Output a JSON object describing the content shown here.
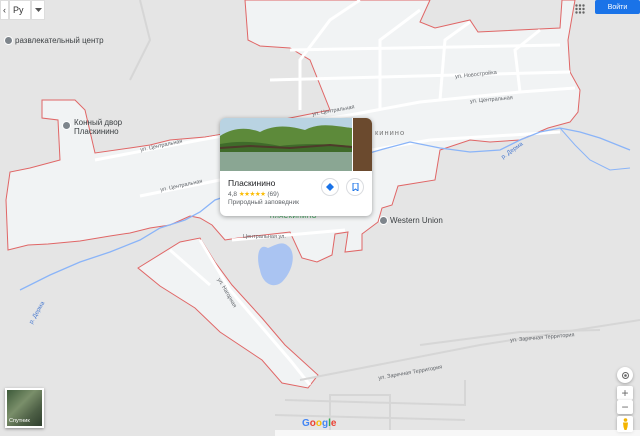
{
  "toolbar": {
    "menu_label": "‹",
    "language": "Ру",
    "language_icon": "chevron-down-icon"
  },
  "labels": {
    "entertainment_center": "развлекательный центр",
    "horse_yard_line1": "Конный двор",
    "horse_yard_line2": "Пласкинино",
    "village_fragment": "кинино",
    "western_union": "Western Union",
    "place_under_pin": "ПЛАСКИНИНО",
    "street_novostroevka": "ул. Новостройка",
    "street_tsentralnaya_1": "ул. Центральная",
    "street_tsentralnaya_2": "ул. Центральная",
    "street_tsentralnaya_3": "ул. Центральная",
    "street_tsentralnaya_4": "ул. Центральная",
    "street_tsentralnaya_5": "Центральная ул.",
    "street_nagornaya": "ул. Нагорная",
    "street_zarechnaya_1": "ул. Заречная Территория",
    "street_zarechnaya_2": "ул. Заречная Территория",
    "river_1": "р. Дерма",
    "river_2": "р. Дерма"
  },
  "place_card": {
    "title": "Пласкинино",
    "rating": "4,8",
    "stars": "★★★★★",
    "reviews": "(69)",
    "type": "Природный заповедник",
    "directions_icon": "directions-icon",
    "save_icon": "bookmark-icon"
  },
  "header": {
    "login_label": "Войти",
    "apps_icon": "apps-grid-icon"
  },
  "controls": {
    "location_icon": "my-location-icon",
    "zoom_in": "+",
    "zoom_out": "−",
    "pegman_icon": "pegman-icon"
  },
  "satellite": {
    "label": "Спутник"
  },
  "google_logo": "Google",
  "colors": {
    "boundary": "#e06666",
    "river": "#8ab4f8",
    "lake": "#aac4f2",
    "built_area": "#f1f3f4",
    "background": "#e5e5e5",
    "accent": "#1a73e8"
  }
}
